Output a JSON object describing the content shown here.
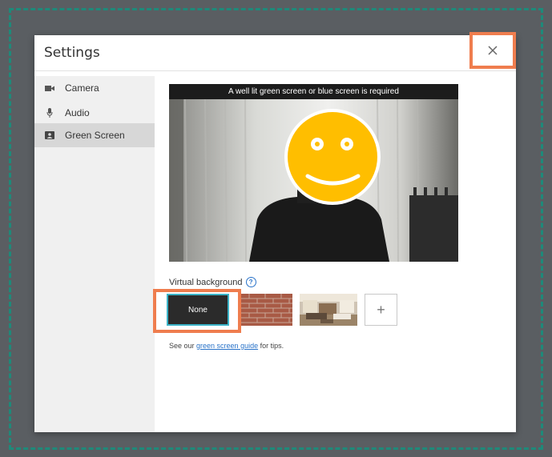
{
  "dialog": {
    "title": "Settings"
  },
  "sidebar": {
    "items": [
      {
        "label": "Camera",
        "icon": "camera-icon",
        "active": false
      },
      {
        "label": "Audio",
        "icon": "microphone-icon",
        "active": false
      },
      {
        "label": "Green Screen",
        "icon": "contact-card-icon",
        "active": true
      }
    ]
  },
  "video": {
    "banner": "A well lit green screen or blue screen is required"
  },
  "virtual_background": {
    "label": "Virtual background",
    "options": [
      {
        "label": "None",
        "selected": true
      },
      {
        "label": "",
        "kind": "brick-wall-image"
      },
      {
        "label": "",
        "kind": "living-room-image"
      },
      {
        "label": "+",
        "kind": "add"
      }
    ]
  },
  "tip": {
    "prefix": "See our ",
    "link": "green screen guide",
    "suffix": " for tips."
  },
  "colors": {
    "highlight": "#ef7d4e",
    "border": "#1e8a7a",
    "link": "#2a73c9"
  }
}
